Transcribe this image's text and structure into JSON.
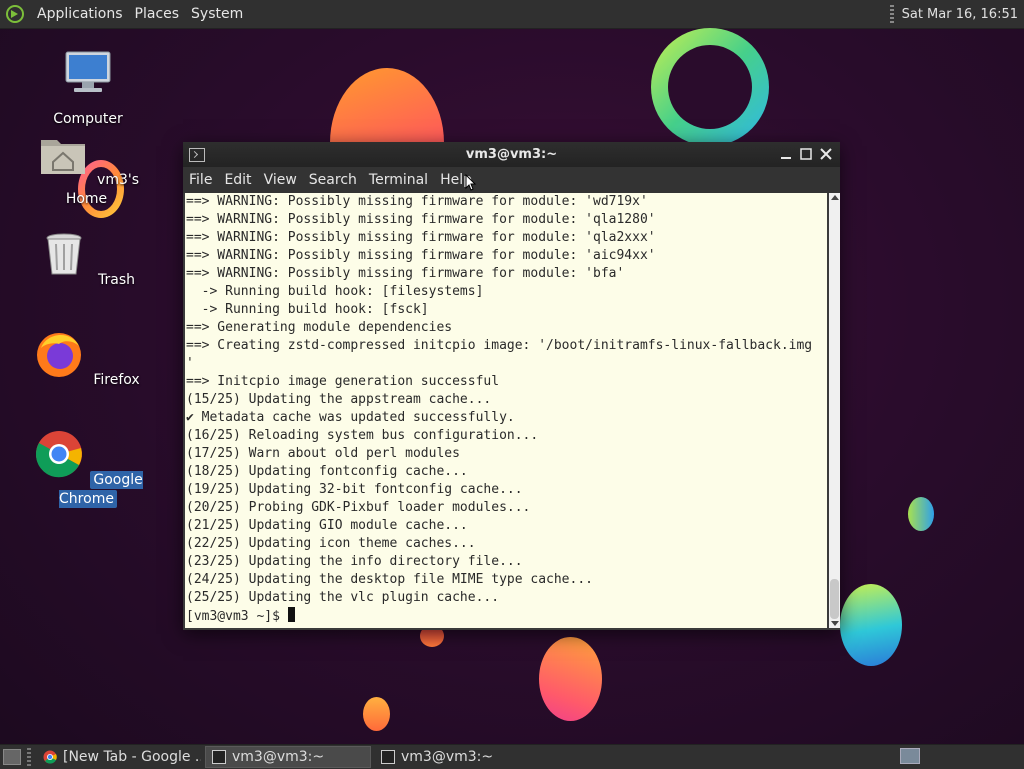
{
  "top_panel": {
    "menus": [
      "Applications",
      "Places",
      "System"
    ],
    "clock": "Sat Mar 16, 16:51"
  },
  "desktop_icons": [
    {
      "label": "Computer",
      "icon": "computer-icon"
    },
    {
      "label": "vm3's Home",
      "icon": "home-folder-icon"
    },
    {
      "label": "Trash",
      "icon": "trash-icon"
    },
    {
      "label": "Firefox",
      "icon": "firefox-icon"
    },
    {
      "label": "Google Chrome",
      "icon": "chrome-icon"
    }
  ],
  "terminal": {
    "title": "vm3@vm3:~",
    "menu": [
      "File",
      "Edit",
      "View",
      "Search",
      "Terminal",
      "Help"
    ],
    "lines": [
      "==> WARNING: Possibly missing firmware for module: 'wd719x'",
      "==> WARNING: Possibly missing firmware for module: 'qla1280'",
      "==> WARNING: Possibly missing firmware for module: 'qla2xxx'",
      "==> WARNING: Possibly missing firmware for module: 'aic94xx'",
      "==> WARNING: Possibly missing firmware for module: 'bfa'",
      "  -> Running build hook: [filesystems]",
      "  -> Running build hook: [fsck]",
      "==> Generating module dependencies",
      "==> Creating zstd-compressed initcpio image: '/boot/initramfs-linux-fallback.img",
      "'",
      "==> Initcpio image generation successful",
      "(15/25) Updating the appstream cache...",
      "✔ Metadata cache was updated successfully.",
      "(16/25) Reloading system bus configuration...",
      "(17/25) Warn about old perl modules",
      "(18/25) Updating fontconfig cache...",
      "(19/25) Updating 32-bit fontconfig cache...",
      "(20/25) Probing GDK-Pixbuf loader modules...",
      "(21/25) Updating GIO module cache...",
      "(22/25) Updating icon theme caches...",
      "(23/25) Updating the info directory file...",
      "(24/25) Updating the desktop file MIME type cache...",
      "(25/25) Updating the vlc plugin cache..."
    ],
    "prompt": "[vm3@vm3 ~]$ "
  },
  "taskbar": {
    "tasks": [
      {
        "label": "[New Tab - Google ...",
        "icon": "chrome-icon",
        "active": false
      },
      {
        "label": "vm3@vm3:~",
        "icon": "terminal-icon",
        "active": true
      },
      {
        "label": "vm3@vm3:~",
        "icon": "terminal-icon",
        "active": false
      }
    ]
  }
}
